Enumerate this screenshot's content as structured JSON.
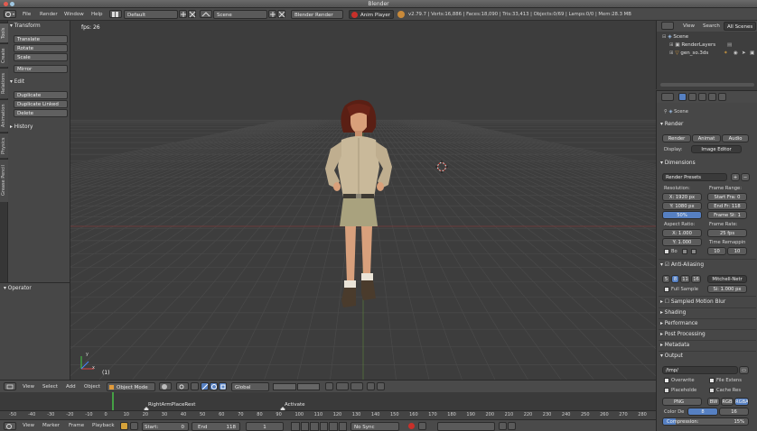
{
  "window": {
    "title": "Blender"
  },
  "info_header": {
    "menus": [
      "File",
      "Render",
      "Window",
      "Help"
    ],
    "layout": "Default",
    "scene": "Scene",
    "engine": "Blender Render",
    "anim_player": "Anim Player",
    "stats": "v2.79.7 | Verts:16,886 | Faces:18,090 | Tris:33,413 | Objects:0/69 | Lamps:0/0 | Mem:28.3 MB"
  },
  "vertical_tabs": [
    "Tools",
    "Create",
    "Relations",
    "Animation",
    "Physics",
    "Grease Pencil"
  ],
  "tool_shelf": {
    "transform_title": "Transform",
    "transform_buttons": [
      "Translate",
      "Rotate",
      "Scale",
      "Mirror"
    ],
    "edit_title": "Edit",
    "edit_buttons": [
      "Duplicate",
      "Duplicate Linked",
      "Delete"
    ],
    "history_title": "History"
  },
  "operator_panel": {
    "title": "Operator"
  },
  "viewport": {
    "fps": "fps: 26",
    "frame_label": "(1)",
    "axis_x": "x",
    "axis_y": "y"
  },
  "viewport_header": {
    "menus": [
      "View",
      "Select",
      "Add",
      "Object"
    ],
    "mode": "Object Mode",
    "orientation": "Global"
  },
  "timeline": {
    "ticks": [
      "-50",
      "-40",
      "-30",
      "-20",
      "-10",
      "0",
      "10",
      "20",
      "30",
      "40",
      "50",
      "60",
      "70",
      "80",
      "90",
      "100",
      "110",
      "120",
      "130",
      "140",
      "150",
      "160",
      "170",
      "180",
      "190",
      "200",
      "210",
      "220",
      "230",
      "240",
      "250",
      "260",
      "270",
      "280",
      "290"
    ],
    "markers": [
      {
        "label": "RightArmPlaceRest"
      },
      {
        "label": "Activate"
      }
    ]
  },
  "timeline_header": {
    "menus": [
      "View",
      "Marker",
      "Frame",
      "Playback"
    ],
    "start_label": "Start:",
    "start_value": "0",
    "end_label": "End",
    "end_value": "118",
    "current_frame": "1",
    "sync": "No Sync"
  },
  "outliner": {
    "menus": [
      "View",
      "Search"
    ],
    "filter": "All Scenes",
    "rows": [
      "Scene",
      "RenderLayers",
      "gen_so.3ds"
    ]
  },
  "properties": {
    "context": "Scene",
    "render_section": "Render",
    "render_buttons": [
      "Render",
      "Animat",
      "Audio"
    ],
    "display_label": "Display:",
    "display_value": "Image Editor",
    "dimensions_section": "Dimensions",
    "render_presets": "Render Presets",
    "resolution_label": "Resolution:",
    "res_x": "X: 1920 px",
    "res_y": "Y: 1080 px",
    "res_pct": "50%",
    "frame_range_label": "Frame Range:",
    "start_fr": "Start Fra: 0",
    "end_fr": "End Fr: 118",
    "frame_step": "Frame St: 1",
    "aspect_label": "Aspect Ratio:",
    "aspect_x": "X: 1.000",
    "aspect_y": "Y: 1.000",
    "frame_rate_label": "Frame Rate:",
    "frame_rate": "25 fps",
    "time_remap_label": "Time Remappin",
    "remap_old": "10",
    "remap_new": "10",
    "bo_label": "Bo",
    "aa_section": "Anti-Aliasing",
    "aa_samples": [
      "5",
      "8",
      "11",
      "16"
    ],
    "aa_filter": "Mitchell-Netr",
    "full_sample": "Full Sample",
    "aa_size": "Si: 1.000 px",
    "sampled_motion_blur": "Sampled Motion Blur",
    "shading": "Shading",
    "performance": "Performance",
    "post_processing": "Post Processing",
    "metadata": "Metadata",
    "output_section": "Output",
    "output_path": "/tmp/",
    "overwrite": "Overwrite",
    "file_extensions": "File Extens",
    "placeholders": "Placeholde",
    "cache_result": "Cache Res",
    "format": "PNG",
    "color_modes": [
      "BW",
      "RGB",
      "RGBA"
    ],
    "color_depth_label": "Color De",
    "color_depth_values": [
      "8",
      "16"
    ],
    "compression": "Compression:",
    "compression_value": "15%",
    "compression_level": 0.15
  },
  "colors": {
    "accent_blue": "#5680c2",
    "record_red": "#c8302a",
    "cursor_red": "#d43b2f",
    "current_frame_green": "#44a044"
  }
}
